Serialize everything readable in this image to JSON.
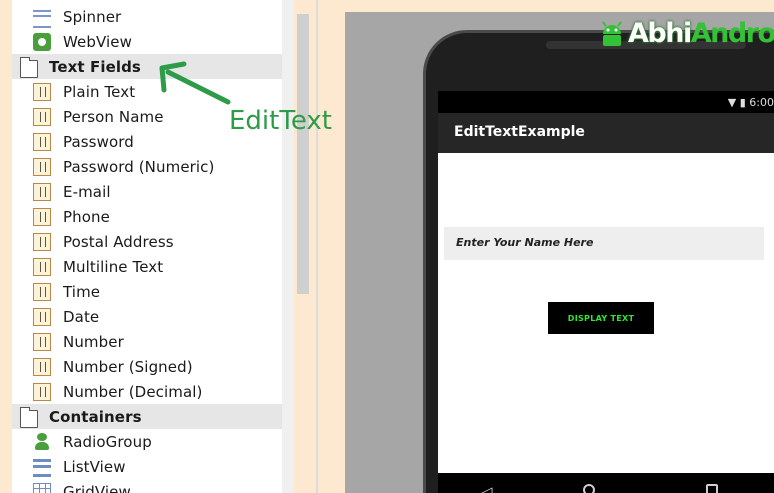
{
  "palette": {
    "items": [
      {
        "label": "Spinner",
        "icon": "spinner-icon",
        "type": "item"
      },
      {
        "label": "WebView",
        "icon": "webview-icon",
        "type": "item"
      },
      {
        "label": "Text Fields",
        "icon": "folder-icon",
        "type": "category"
      },
      {
        "label": "Plain Text",
        "icon": "text-field-icon",
        "type": "item"
      },
      {
        "label": "Person Name",
        "icon": "text-field-icon",
        "type": "item"
      },
      {
        "label": "Password",
        "icon": "text-field-icon",
        "type": "item"
      },
      {
        "label": "Password (Numeric)",
        "icon": "text-field-icon",
        "type": "item"
      },
      {
        "label": "E-mail",
        "icon": "text-field-icon",
        "type": "item"
      },
      {
        "label": "Phone",
        "icon": "text-field-icon",
        "type": "item"
      },
      {
        "label": "Postal Address",
        "icon": "text-field-icon",
        "type": "item"
      },
      {
        "label": "Multiline Text",
        "icon": "text-field-icon",
        "type": "item"
      },
      {
        "label": "Time",
        "icon": "text-field-icon",
        "type": "item"
      },
      {
        "label": "Date",
        "icon": "text-field-icon",
        "type": "item"
      },
      {
        "label": "Number",
        "icon": "text-field-icon",
        "type": "item"
      },
      {
        "label": "Number (Signed)",
        "icon": "text-field-icon",
        "type": "item"
      },
      {
        "label": "Number (Decimal)",
        "icon": "text-field-icon",
        "type": "item"
      },
      {
        "label": "Containers",
        "icon": "folder-icon",
        "type": "category"
      },
      {
        "label": "RadioGroup",
        "icon": "radiogroup-icon",
        "type": "item"
      },
      {
        "label": "ListView",
        "icon": "listview-icon",
        "type": "item"
      },
      {
        "label": "GridView",
        "icon": "gridview-icon",
        "type": "item"
      }
    ]
  },
  "annotation": {
    "label": "EditText",
    "color": "#2e9b48"
  },
  "device": {
    "status_time": "6:00",
    "app_title": "EditTextExample",
    "edit_hint": "Enter Your Name Here",
    "button_label": "DISPLAY TEXT",
    "button_text_color": "#2ee82e"
  },
  "watermark": {
    "part1": "Abhi",
    "part2": "Androi"
  }
}
